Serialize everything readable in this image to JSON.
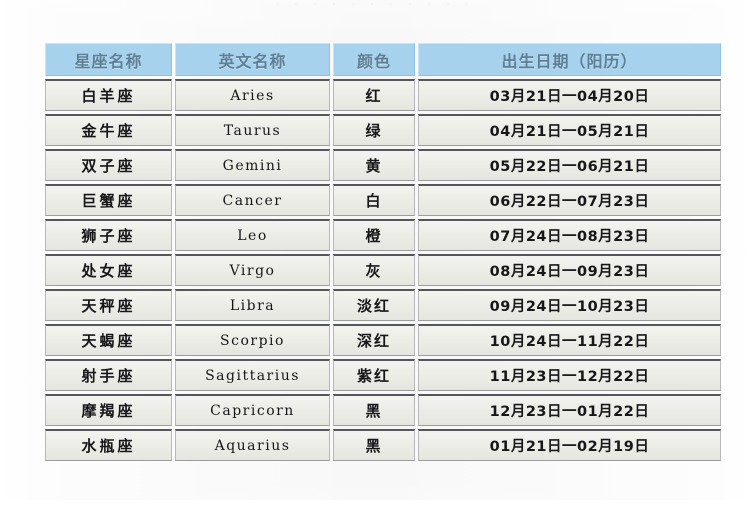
{
  "page": {
    "top_cut_text": "· · · · ·   · ·   · · · ·"
  },
  "table": {
    "name": "zodiac-sign-table",
    "header_bg": "#a6d2ee",
    "header_text_color": "#5f7f94",
    "cell_bg": "#eeeeea",
    "columns": [
      "星座名称",
      "英文名称",
      "颜色",
      "出生日期（阳历）"
    ],
    "rows": [
      {
        "cn": "白羊座",
        "en": "Aries",
        "color": "红",
        "date": "03月21日一04月20日"
      },
      {
        "cn": "金牛座",
        "en": "Taurus",
        "color": "绿",
        "date": "04月21日一05月21日"
      },
      {
        "cn": "双子座",
        "en": "Gemini",
        "color": "黄",
        "date": "05月22日一06月21日"
      },
      {
        "cn": "巨蟹座",
        "en": "Cancer",
        "color": "白",
        "date": "06月22日一07月23日"
      },
      {
        "cn": "狮子座",
        "en": "Leo",
        "color": "橙",
        "date": "07月24日一08月23日"
      },
      {
        "cn": "处女座",
        "en": "Virgo",
        "color": "灰",
        "date": "08月24日一09月23日"
      },
      {
        "cn": "天秤座",
        "en": "Libra",
        "color": "淡红",
        "date": "09月24日一10月23日"
      },
      {
        "cn": "天蝎座",
        "en": "Scorpio",
        "color": "深红",
        "date": "10月24日一11月22日"
      },
      {
        "cn": "射手座",
        "en": "Sagittarius",
        "color": "紫红",
        "date": "11月23日一12月22日"
      },
      {
        "cn": "摩羯座",
        "en": "Capricorn",
        "color": "黑",
        "date": "12月23日一01月22日"
      },
      {
        "cn": "水瓶座",
        "en": "Aquarius",
        "color": "黑",
        "date": "01月21日一02月19日"
      }
    ]
  }
}
